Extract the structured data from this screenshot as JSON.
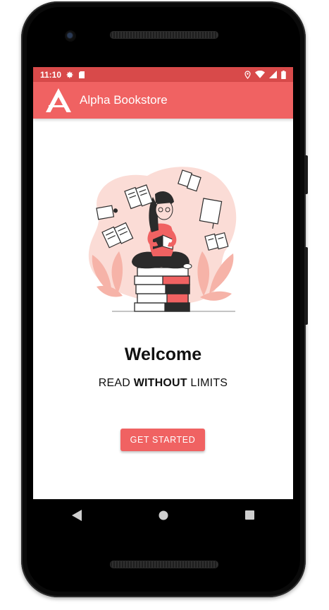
{
  "status_bar": {
    "time": "11:10",
    "icons": [
      "gear-icon",
      "sd-card-icon",
      "location-icon",
      "wifi-icon",
      "signal-icon",
      "battery-icon"
    ]
  },
  "app_bar": {
    "title": "Alpha Bookstore",
    "logo": "alpha-logo-icon"
  },
  "welcome": {
    "title": "Welcome",
    "tagline_pre": "READ ",
    "tagline_bold": "WITHOUT",
    "tagline_post": " LIMITS"
  },
  "cta": {
    "label": "GET STARTED"
  },
  "nav_bar": {
    "icons": [
      "back-icon",
      "home-icon",
      "recents-icon"
    ]
  },
  "colors": {
    "status_bar": "#d84a4a",
    "app_bar": "#f06262",
    "accent": "#f06262",
    "illustration_blob": "#fbdcd6"
  }
}
